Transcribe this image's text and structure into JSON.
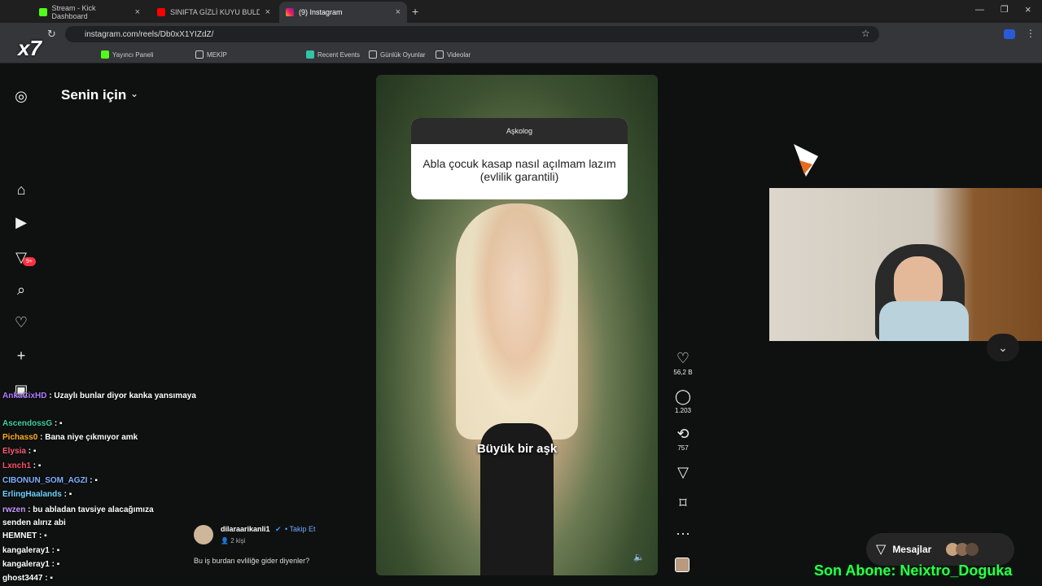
{
  "browser": {
    "tabs": [
      {
        "label": "Stream - Kick Dashboard"
      },
      {
        "label": "SINIFTA GİZLİ KUYU BULDUK!"
      },
      {
        "label": "(9) Instagram"
      }
    ],
    "url": "instagram.com/reels/Db0xX1YIZdZ/",
    "bookmarks": [
      "Yayıncı Paneli",
      "MEKİP",
      "Recent Events",
      "Günlük Oyunlar",
      "Videolar"
    ]
  },
  "instagram": {
    "feed_title": "Senin için",
    "messages_badge": "9+",
    "question_box": {
      "header": "Aşkolog",
      "question": "Abla çocuk kasap nasıl açılmam lazım (evlilik garantili)"
    },
    "caption": "Büyük bir aşk",
    "author": {
      "username": "dilaraarikanli1",
      "follow_label": "Takip Et",
      "audience": "2 kişi",
      "description": "Bu iş burdan evliliğe gider diyenler?"
    },
    "actions": {
      "likes": "56,2 B",
      "comments": "1.203",
      "reposts": "757"
    },
    "messages_label": "Mesajlar"
  },
  "stream_overlay": {
    "logo_text": "x7",
    "subscriber_banner": "Son Abone: Neixtro_Doguka",
    "chat": [
      {
        "user": "AnkaCixHD",
        "text": "Uzaylı bunlar diyor kanka yansımaya",
        "color": "#b07cff"
      },
      {
        "user": "AscendossG",
        "text": "",
        "color": "#3fd0a0"
      },
      {
        "user": "Pichass0",
        "text": "Bana niye çıkmıyor amk",
        "color": "#ffb020"
      },
      {
        "user": "Elysia",
        "text": "",
        "color": "#ff5a7a"
      },
      {
        "user": "Lxnch1",
        "text": "",
        "color": "#ff4d6a"
      },
      {
        "user": "CIBONUN_SOM_AGZI",
        "text": "",
        "color": "#7fb0ff"
      },
      {
        "user": "ErlingHaalands",
        "text": "",
        "color": "#6fd3ff"
      },
      {
        "user": "rwzen",
        "text": "bu abladan tavsiye alacağımıza senden alırız abi",
        "color": "#c89bff"
      },
      {
        "user": "HEMNET",
        "text": "",
        "color": "#ffffff"
      },
      {
        "user": "kangaleray1",
        "text": "",
        "color": "#ffffff"
      },
      {
        "user": "kangaleray1",
        "text": "",
        "color": "#ffffff"
      },
      {
        "user": "ghost3447",
        "text": "",
        "color": "#ffffff"
      }
    ]
  }
}
